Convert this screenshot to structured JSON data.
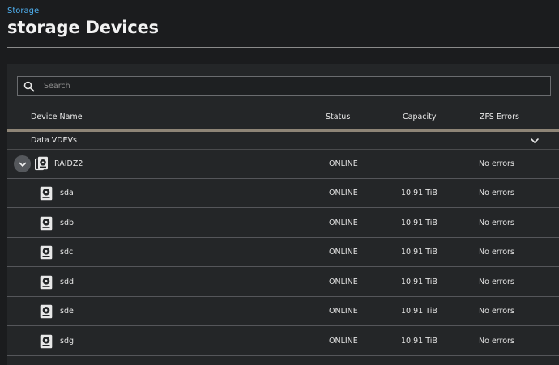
{
  "breadcrumb": "Storage",
  "page_title": "storage Devices",
  "search": {
    "placeholder": "Search",
    "value": ""
  },
  "columns": {
    "name": "Device Name",
    "status": "Status",
    "capacity": "Capacity",
    "zfs_errors": "ZFS Errors"
  },
  "group": {
    "label": "Data VDEVs",
    "icon": "chevron-down-icon"
  },
  "vdev": {
    "name": "RAIDZ2",
    "status": "ONLINE",
    "capacity": "",
    "zfs_errors": "No errors",
    "icon": "raidz-icon"
  },
  "disks": [
    {
      "name": "sda",
      "status": "ONLINE",
      "capacity": "10.91 TiB",
      "zfs_errors": "No errors"
    },
    {
      "name": "sdb",
      "status": "ONLINE",
      "capacity": "10.91 TiB",
      "zfs_errors": "No errors"
    },
    {
      "name": "sdc",
      "status": "ONLINE",
      "capacity": "10.91 TiB",
      "zfs_errors": "No errors"
    },
    {
      "name": "sdd",
      "status": "ONLINE",
      "capacity": "10.91 TiB",
      "zfs_errors": "No errors"
    },
    {
      "name": "sde",
      "status": "ONLINE",
      "capacity": "10.91 TiB",
      "zfs_errors": "No errors"
    },
    {
      "name": "sdg",
      "status": "ONLINE",
      "capacity": "10.91 TiB",
      "zfs_errors": "No errors"
    }
  ],
  "colors": {
    "accent": "#4fb0f0",
    "background": "#1b1c1e",
    "card": "#242628",
    "header_rule": "#8e8577"
  }
}
